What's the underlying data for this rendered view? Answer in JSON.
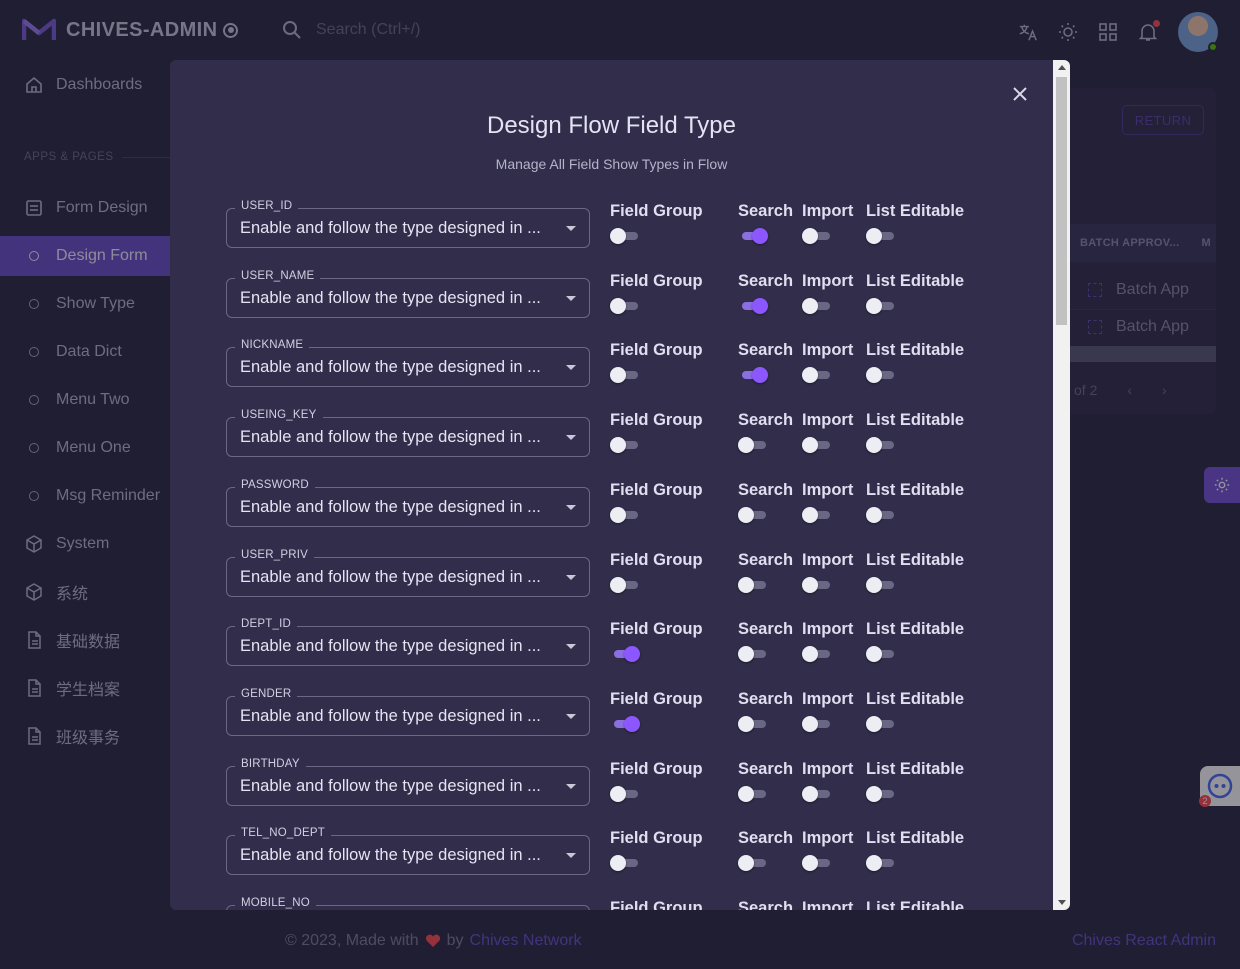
{
  "app": {
    "title": "CHIVES-ADMIN"
  },
  "search": {
    "placeholder": "Search (Ctrl+/)"
  },
  "sidebar": {
    "section_label": "APPS & PAGES",
    "items": [
      {
        "label": "Dashboards",
        "icon": "home-icon"
      },
      {
        "label": "Form Design",
        "icon": "form-icon"
      },
      {
        "label": "Design Form",
        "icon": "circle-icon",
        "active": true
      },
      {
        "label": "Show Type",
        "icon": "circle-icon"
      },
      {
        "label": "Data Dict",
        "icon": "circle-icon"
      },
      {
        "label": "Menu Two",
        "icon": "circle-icon"
      },
      {
        "label": "Menu One",
        "icon": "circle-icon"
      },
      {
        "label": "Msg Reminder",
        "icon": "circle-icon"
      },
      {
        "label": "System",
        "icon": "cube-icon"
      },
      {
        "label": "系统",
        "icon": "cube-icon"
      },
      {
        "label": "基础数据",
        "icon": "file-icon"
      },
      {
        "label": "学生档案",
        "icon": "file-icon"
      },
      {
        "label": "班级事务",
        "icon": "file-icon"
      }
    ]
  },
  "background": {
    "return_label": "RETURN",
    "column_header": "BATCH APPROV...",
    "column_header_2": "M",
    "rows": [
      "Batch App",
      "Batch App"
    ],
    "pager_text": "of 2"
  },
  "footer": {
    "left_prefix": "© 2023, Made with",
    "by": "by",
    "link": "Chives Network",
    "right": "Chives React Admin"
  },
  "modal": {
    "title": "Design Flow Field Type",
    "subtitle": "Manage All Field Show Types in Flow",
    "column_labels": {
      "field_group": "Field Group",
      "search": "Search",
      "import": "Import",
      "list_editable": "List Editable"
    },
    "select_value": "Enable and follow the type designed in ...",
    "rows": [
      {
        "field": "USER_ID",
        "field_group": false,
        "search": true,
        "import": false,
        "list_editable": false
      },
      {
        "field": "USER_NAME",
        "field_group": false,
        "search": true,
        "import": false,
        "list_editable": false
      },
      {
        "field": "NICKNAME",
        "field_group": false,
        "search": true,
        "import": false,
        "list_editable": false
      },
      {
        "field": "USEING_KEY",
        "field_group": false,
        "search": false,
        "import": false,
        "list_editable": false
      },
      {
        "field": "PASSWORD",
        "field_group": false,
        "search": false,
        "import": false,
        "list_editable": false
      },
      {
        "field": "USER_PRIV",
        "field_group": false,
        "search": false,
        "import": false,
        "list_editable": false
      },
      {
        "field": "DEPT_ID",
        "field_group": true,
        "search": false,
        "import": false,
        "list_editable": false
      },
      {
        "field": "GENDER",
        "field_group": true,
        "search": false,
        "import": false,
        "list_editable": false
      },
      {
        "field": "BIRTHDAY",
        "field_group": false,
        "search": false,
        "import": false,
        "list_editable": false
      },
      {
        "field": "TEL_NO_DEPT",
        "field_group": false,
        "search": false,
        "import": false,
        "list_editable": false
      },
      {
        "field": "MOBILE_NO",
        "field_group": false,
        "search": false,
        "import": false,
        "list_editable": false
      }
    ]
  },
  "chat": {
    "badge": "2"
  },
  "colors": {
    "primary": "#8c57ff",
    "background": "#2a2840",
    "surface": "#312d4b",
    "active_nav": "#6b4fc7"
  }
}
